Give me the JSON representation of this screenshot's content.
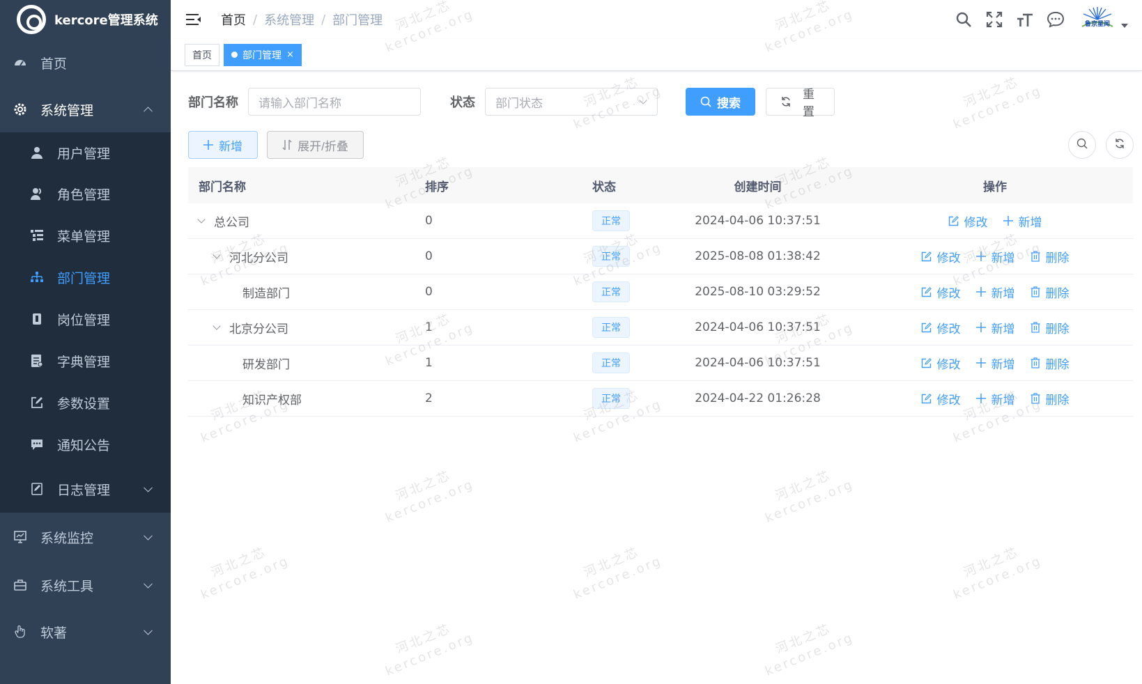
{
  "app": {
    "title": "kercore管理系统"
  },
  "sidebar": {
    "home": "首页",
    "system": "系统管理",
    "sub_items": [
      {
        "label": "用户管理",
        "icon": "user-icon"
      },
      {
        "label": "角色管理",
        "icon": "peoples-icon"
      },
      {
        "label": "菜单管理",
        "icon": "tree-table-icon"
      },
      {
        "label": "部门管理",
        "icon": "tree-icon"
      },
      {
        "label": "岗位管理",
        "icon": "post-icon"
      },
      {
        "label": "字典管理",
        "icon": "dict-icon"
      },
      {
        "label": "参数设置",
        "icon": "edit-icon"
      },
      {
        "label": "通知公告",
        "icon": "message-icon"
      },
      {
        "label": "日志管理",
        "icon": "log-icon"
      }
    ],
    "monitor": "系统监控",
    "tool": "系统工具",
    "software": "软著"
  },
  "navbar": {
    "breadcrumb": [
      "首页",
      "系统管理",
      "部门管理"
    ],
    "avatar_text": "鲁京星闻"
  },
  "tags": {
    "home": "首页",
    "current": "部门管理",
    "close": "×"
  },
  "search": {
    "dept_label": "部门名称",
    "dept_placeholder": "请输入部门名称",
    "status_label": "状态",
    "status_placeholder": "部门状态",
    "search_btn": "搜索",
    "reset_btn": "重置"
  },
  "toolbar": {
    "add": "新增",
    "toggle": "展开/折叠"
  },
  "table": {
    "headers": {
      "name": "部门名称",
      "order": "排序",
      "status": "状态",
      "time": "创建时间",
      "ops": "操作"
    },
    "ops": {
      "edit": "修改",
      "add": "新增",
      "delete": "删除"
    },
    "rows": [
      {
        "name": "总公司",
        "order": "0",
        "status": "正常",
        "time": "2024-04-06 10:37:51"
      },
      {
        "name": "河北分公司",
        "order": "0",
        "status": "正常",
        "time": "2025-08-08 01:38:42"
      },
      {
        "name": "制造部门",
        "order": "0",
        "status": "正常",
        "time": "2025-08-10 03:29:52"
      },
      {
        "name": "北京分公司",
        "order": "1",
        "status": "正常",
        "time": "2024-04-06 10:37:51"
      },
      {
        "name": "研发部门",
        "order": "1",
        "status": "正常",
        "time": "2024-04-06 10:37:51"
      },
      {
        "name": "知识产权部",
        "order": "2",
        "status": "正常",
        "time": "2024-04-22 01:26:28"
      }
    ]
  },
  "watermark": {
    "line1": "河北之芯",
    "line2": "kercore.org"
  },
  "colors": {
    "sidebar_bg": "#304156",
    "submenu_bg": "#1f2d3d",
    "primary": "#409eff"
  }
}
